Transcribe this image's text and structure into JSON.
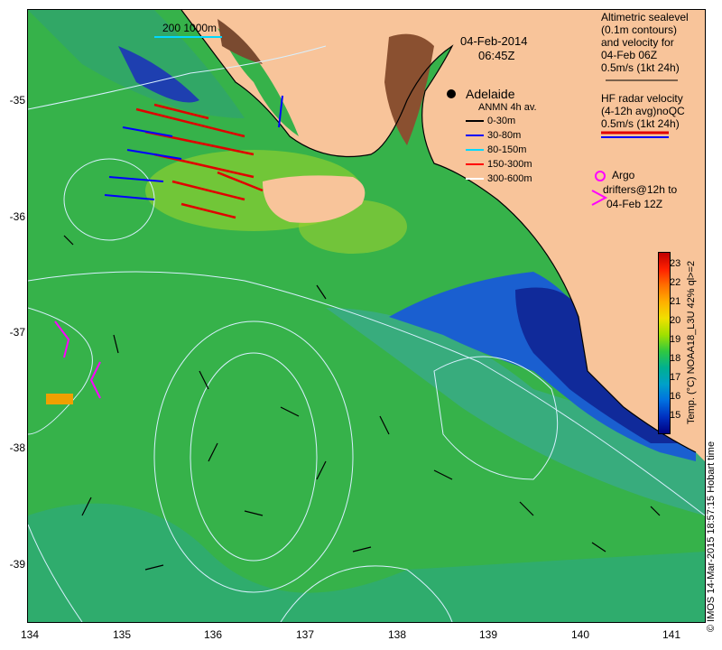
{
  "title": {
    "date": "04-Feb-2014",
    "time": "06:45Z"
  },
  "scale_bar": {
    "label": "200   1000m"
  },
  "city": {
    "name": "Adelaide"
  },
  "altimetry_legend": {
    "lines": [
      "Altimetric sealevel",
      "(0.1m contours)",
      "and velocity for",
      "04-Feb 06Z",
      "0.5m/s (1kt 24h)"
    ]
  },
  "hf_legend": {
    "lines": [
      "HF radar velocity",
      "(4-12h avg)noQC",
      "0.5m/s (1kt 24h)"
    ]
  },
  "anmn_legend": {
    "title": "ANMN 4h av.",
    "items": [
      {
        "label": "0-30m",
        "color": "#000000"
      },
      {
        "label": "30-80m",
        "color": "#0000ff"
      },
      {
        "label": "80-150m",
        "color": "#00d8ff"
      },
      {
        "label": "150-300m",
        "color": "#ff0000"
      },
      {
        "label": "300-600m",
        "color": "#ffffff"
      }
    ]
  },
  "argo_legend": {
    "lines": [
      "Argo",
      "drifters@12h to",
      "04-Feb 12Z"
    ],
    "color": "#ff00ff"
  },
  "colorbar": {
    "label": "Temp. (°C) NOAA18_L3U 42% ql>=2",
    "ticks": [
      "23",
      "22",
      "21",
      "20",
      "19",
      "18",
      "17",
      "16",
      "15"
    ],
    "colors": [
      "#c00000",
      "#ff2000",
      "#ff7000",
      "#ffb000",
      "#f0e000",
      "#a0e000",
      "#30c840",
      "#00b090",
      "#00a0c8",
      "#0070e0",
      "#0030c0",
      "#000080"
    ]
  },
  "axes": {
    "lon_ticks": [
      "134",
      "135",
      "136",
      "137",
      "138",
      "139",
      "140",
      "141"
    ],
    "lat_ticks": [
      "-35",
      "-36",
      "-37",
      "-38",
      "-39"
    ]
  },
  "credit": "© IMOS 14-Mar-2015 18:57:15 Hobart time"
}
